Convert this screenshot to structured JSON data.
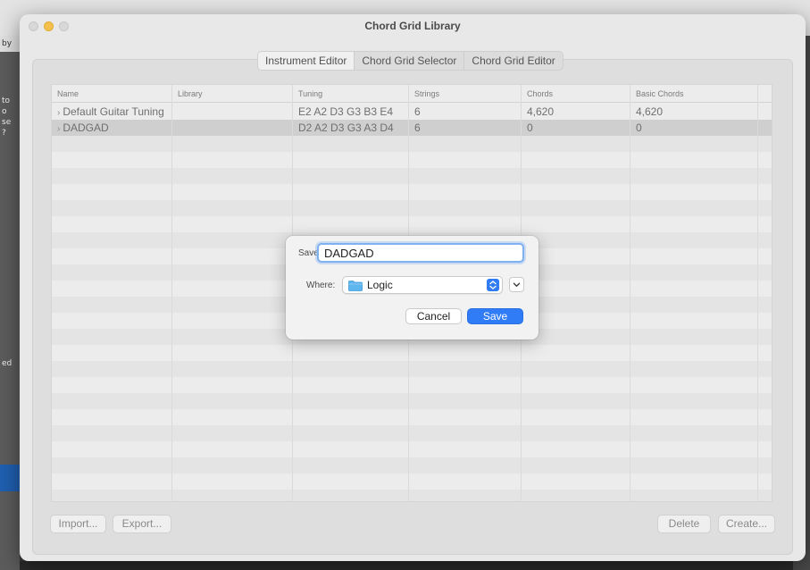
{
  "background": {
    "left_text": [
      "by",
      "to",
      "o",
      "se",
      "?",
      "ed"
    ]
  },
  "window": {
    "title": "Chord Grid Library"
  },
  "tabs": [
    {
      "label": "Instrument Editor",
      "active": true
    },
    {
      "label": "Chord Grid Selector",
      "active": false
    },
    {
      "label": "Chord Grid Editor",
      "active": false
    }
  ],
  "table": {
    "columns": [
      "Name",
      "Library",
      "Tuning",
      "Strings",
      "Chords",
      "Basic Chords"
    ],
    "rows": [
      {
        "name": "Default Guitar Tuning",
        "library": "",
        "tuning": "E2 A2 D3 G3 B3 E4",
        "strings": "6",
        "chords": "4,620",
        "basic_chords": "4,620"
      },
      {
        "name": "DADGAD",
        "library": "",
        "tuning": "D2 A2 D3 G3 A3 D4",
        "strings": "6",
        "chords": "0",
        "basic_chords": "0"
      }
    ],
    "selected_row": 1
  },
  "buttons": {
    "import": "Import...",
    "export": "Export...",
    "delete": "Delete",
    "create": "Create..."
  },
  "dialog": {
    "save_as_label": "Save As:",
    "save_as_value": "DADGAD",
    "where_label": "Where:",
    "where_value": "Logic",
    "cancel": "Cancel",
    "save": "Save"
  },
  "colors": {
    "accent": "#2f7cf6",
    "folder": "#5fb5ee",
    "traffic_min": "#f3c14b"
  }
}
